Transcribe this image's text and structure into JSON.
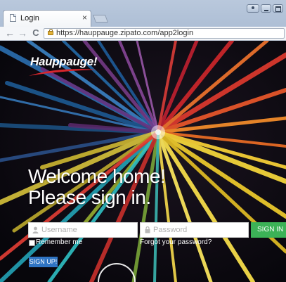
{
  "browser": {
    "tab_title": "Login",
    "tab_close": "×",
    "url": "https://hauppauge.zipato.com/app2login",
    "nav": {
      "back": "←",
      "forward": "→",
      "reload": "C"
    }
  },
  "page": {
    "logo": "Hauppauge!",
    "headline": "Welcome home!",
    "subheadline": "Please sign in.",
    "login_form": {
      "username_placeholder": "Username",
      "password_placeholder": "Password",
      "signin_label": "SIGN IN",
      "remember_label": "Remember me",
      "forgot_label": "Forgot your password?",
      "signup_label": "SIGN UP!"
    }
  },
  "colors": {
    "signin_button": "#3cb257",
    "signup_button": "#2f74c3",
    "logo_swoosh": "#d8262c",
    "chrome_frame": "#b9c8dc"
  }
}
